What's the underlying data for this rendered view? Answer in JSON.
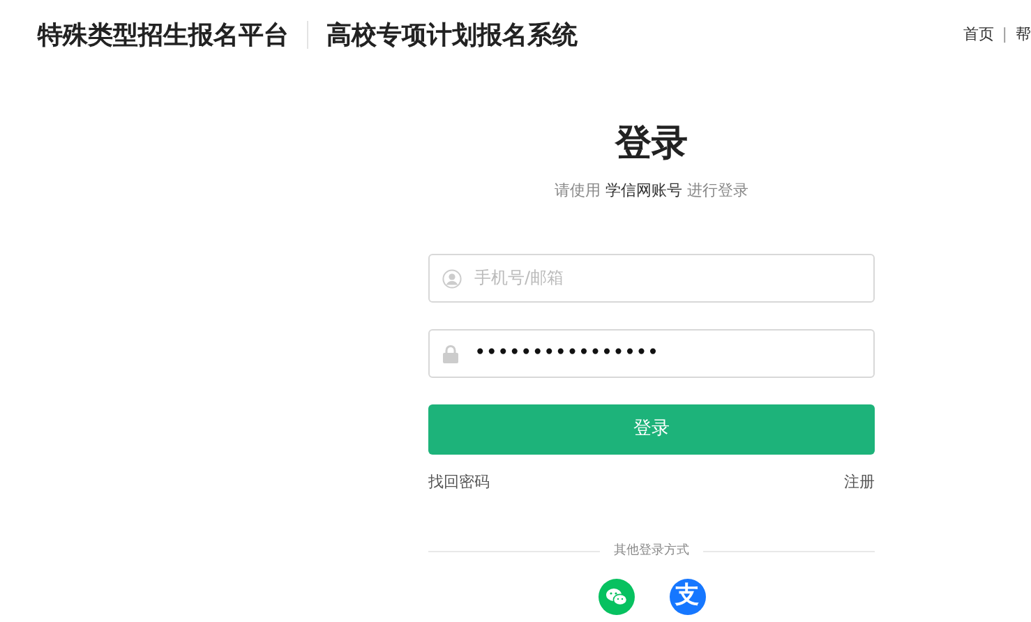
{
  "header": {
    "brand": "特殊类型招生报名平台",
    "system": "高校专项计划报名系统",
    "nav": [
      {
        "label": "首页"
      },
      {
        "label": "帮"
      }
    ],
    "nav_separator": "|"
  },
  "login": {
    "title": "登录",
    "subtitle": "请使用 **学信网账号** 进行登录",
    "fields": [
      {
        "kind": "user",
        "placeholder": "手机号/邮箱"
      },
      {
        "kind": "password",
        "value": "••••••••••••••••"
      }
    ],
    "submit": "登录",
    "forgot": "找回密码",
    "register": "注册",
    "other_label": "其他登录方式",
    "social": [
      {
        "kind": "wechat"
      },
      {
        "kind": "alipay",
        "glyph": "支"
      }
    ]
  }
}
